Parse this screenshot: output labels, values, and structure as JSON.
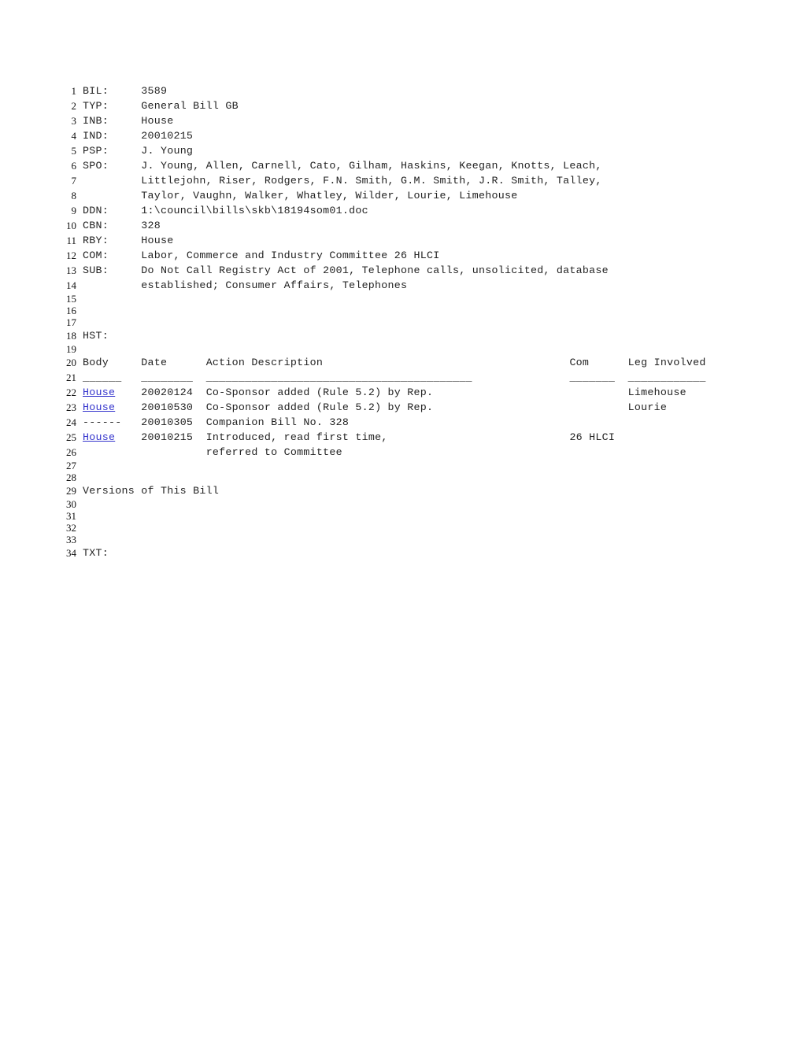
{
  "document": {
    "fields": [
      {
        "line": 1,
        "label": "BIL:",
        "value": "3589"
      },
      {
        "line": 2,
        "label": "TYP:",
        "value": "General Bill GB"
      },
      {
        "line": 3,
        "label": "INB:",
        "value": "House"
      },
      {
        "line": 4,
        "label": "IND:",
        "value": "20010215"
      },
      {
        "line": 5,
        "label": "PSP:",
        "value": "J. Young"
      },
      {
        "line": 6,
        "label": "SPO:",
        "value": "J. Young, Allen, Carnell, Cato, Gilham, Haskins, Keegan, Knotts, Leach,"
      },
      {
        "line": 7,
        "label": "",
        "value": "Littlejohn, Riser, Rodgers, F.N. Smith, G.M. Smith, J.R. Smith, Talley,"
      },
      {
        "line": 8,
        "label": "",
        "value": "Taylor, Vaughn, Walker, Whatley, Wilder, Lourie, Limehouse"
      },
      {
        "line": 9,
        "label": "DDN:",
        "value": "1:\\council\\bills\\skb\\18194som01.doc"
      },
      {
        "line": 10,
        "label": "CBN:",
        "value": "328"
      },
      {
        "line": 11,
        "label": "RBY:",
        "value": "House"
      },
      {
        "line": 12,
        "label": "COM:",
        "value": "Labor, Commerce and Industry Committee 26 HLCI"
      },
      {
        "line": 13,
        "label": "SUB:",
        "value": "Do Not Call Registry Act of 2001, Telephone calls, unsolicited, database"
      },
      {
        "line": 14,
        "label": "",
        "value": "established; Consumer Affairs, Telephones"
      }
    ],
    "history_label": {
      "line": 18,
      "text": "HST:"
    },
    "history_header": {
      "line": 20,
      "body": "Body",
      "date": "Date",
      "action": "Action Description",
      "com": "Com",
      "leg": "Leg Involved"
    },
    "history_rule": {
      "line": 21,
      "body": "______",
      "date": "________",
      "action": "_________________________________________",
      "com": "_______",
      "leg": "____________"
    },
    "history_rows": [
      {
        "line": 22,
        "body": "House",
        "body_is_link": true,
        "date": "20020124",
        "action": "Co-Sponsor added (Rule 5.2) by Rep.",
        "com": "",
        "leg": "Limehouse"
      },
      {
        "line": 23,
        "body": "House",
        "body_is_link": true,
        "date": "20010530",
        "action": "Co-Sponsor added (Rule 5.2) by Rep.",
        "com": "",
        "leg": "Lourie"
      },
      {
        "line": 24,
        "body": "------",
        "body_is_link": false,
        "date": "20010305",
        "action": "Companion Bill No. 328",
        "com": "",
        "leg": ""
      },
      {
        "line": 25,
        "body": "House",
        "body_is_link": true,
        "date": "20010215",
        "action": "Introduced, read first time,",
        "com": "26 HLCI",
        "leg": ""
      },
      {
        "line": 26,
        "body": "",
        "body_is_link": false,
        "date": "",
        "action": "referred to Committee",
        "com": "",
        "leg": ""
      }
    ],
    "versions_heading": {
      "line": 29,
      "text": "Versions of This Bill"
    },
    "text_label": {
      "line": 34,
      "text": "TXT:"
    },
    "blank_lines": [
      15,
      16,
      17,
      19,
      27,
      28,
      30,
      31,
      32,
      33
    ],
    "colors": {
      "text": "#222222",
      "link": "#3333cc",
      "background": "#ffffff"
    }
  }
}
